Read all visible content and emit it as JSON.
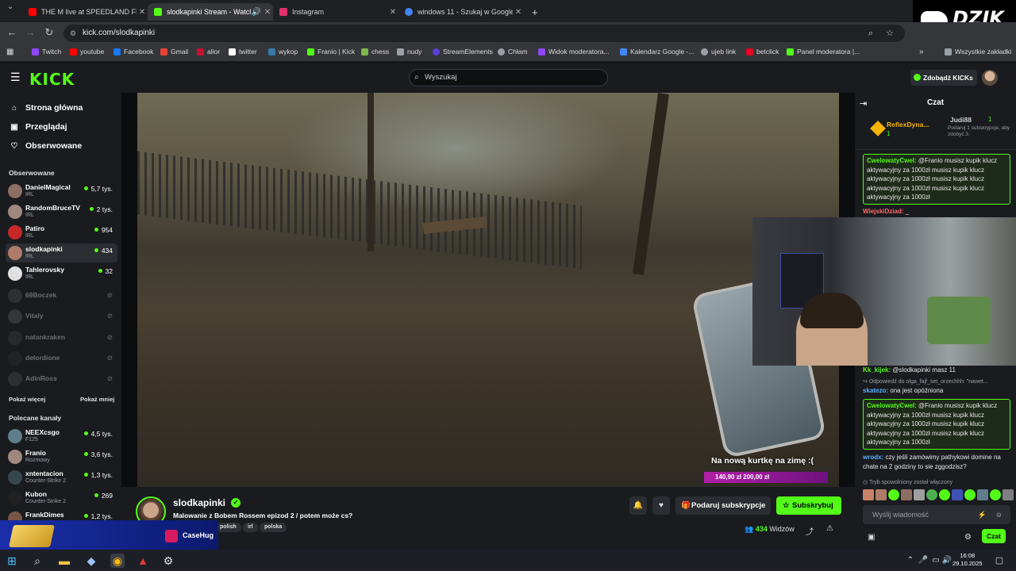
{
  "browser": {
    "tabs": [
      {
        "title": "THE M live at SPEEDLAND FEST",
        "color": "#ff0000"
      },
      {
        "title": "slodkapinki Stream - Watch",
        "color": "#53fc18"
      },
      {
        "title": "Instagram",
        "color": "#e1306c"
      },
      {
        "title": "windows 11 - Szukaj w Google",
        "color": "#4285f4"
      }
    ],
    "url": "kick.com/slodkapinki",
    "bookmarks": [
      {
        "label": "Twitch",
        "color": "#9146ff"
      },
      {
        "label": "youtube",
        "color": "#ff0000"
      },
      {
        "label": "Facebook",
        "color": "#1877f2"
      },
      {
        "label": "Gmail",
        "color": "#ea4335"
      },
      {
        "label": "alior",
        "color": "#c8102e"
      },
      {
        "label": "twitter",
        "color": "#ffffff"
      },
      {
        "label": "wykop",
        "color": "#367aa9"
      },
      {
        "label": "Franio | Kick",
        "color": "#53fc18"
      },
      {
        "label": "chess",
        "color": "#81b64c"
      },
      {
        "label": "nudy",
        "color": "#9aa0a6"
      },
      {
        "label": "StreamElements",
        "color": "#5a3fd6"
      },
      {
        "label": "Chłam",
        "color": "#9aa0a6"
      },
      {
        "label": "Widok moderatora...",
        "color": "#9146ff"
      },
      {
        "label": "Kalendarz Google -...",
        "color": "#4285f4"
      },
      {
        "label": "ujeb link",
        "color": "#9aa0a6"
      },
      {
        "label": "betclick",
        "color": "#e40521"
      },
      {
        "label": "Panel moderatora |...",
        "color": "#53fc18"
      }
    ],
    "all_bookmarks": "Wszystkie zakładki"
  },
  "kick": {
    "logo": "KICK",
    "search_placeholder": "Wyszukaj",
    "kicks_button": "Zdobądź KICKs",
    "nav": [
      "Strona główna",
      "Przeglądaj",
      "Obserwowane"
    ],
    "followed_heading": "Obserwowane",
    "followed": [
      {
        "name": "DanielMagical",
        "cat": "IRL",
        "viewers": "5,7 tys.",
        "color": "#8d6e63"
      },
      {
        "name": "RandomBruceTV",
        "cat": "IRL",
        "viewers": "2 tys.",
        "color": "#a1887f"
      },
      {
        "name": "Patiro",
        "cat": "IRL",
        "viewers": "954",
        "color": "#c62828"
      },
      {
        "name": "slodkapinki",
        "cat": "IRL",
        "viewers": "434",
        "color": "#b07c6a"
      },
      {
        "name": "Tahlerovsky",
        "cat": "IRL",
        "viewers": "32",
        "color": "#e0e0e0"
      },
      {
        "name": "69Boczek",
        "cat": "",
        "viewers": "",
        "color": "#555555"
      },
      {
        "name": "Vitaly",
        "cat": "",
        "viewers": "",
        "color": "#666666"
      },
      {
        "name": "natankraken",
        "cat": "",
        "viewers": "",
        "color": "#444444"
      },
      {
        "name": "delordione",
        "cat": "",
        "viewers": "",
        "color": "#333333"
      },
      {
        "name": "AdinRoss",
        "cat": "",
        "viewers": "",
        "color": "#555555"
      }
    ],
    "show_more": "Pokaż więcej",
    "show_less": "Pokaż mniej",
    "recommended_heading": "Polecane kanały",
    "recommended": [
      {
        "name": "NEEXcsgo",
        "cat": "F125",
        "viewers": "4,5 tys.",
        "color": "#607d8b"
      },
      {
        "name": "Franio",
        "cat": "Rozmowy",
        "viewers": "3,6 tys.",
        "color": "#a1887f"
      },
      {
        "name": "xntentacion",
        "cat": "Counter-Strike 2",
        "viewers": "1,3 tys.",
        "color": "#37474f"
      },
      {
        "name": "Kubon",
        "cat": "Counter-Strike 2",
        "viewers": "269",
        "color": "#212121"
      },
      {
        "name": "FrankDimes",
        "cat": "",
        "viewers": "1,2 tys.",
        "color": "#795548"
      }
    ]
  },
  "video": {
    "caption": "Na nową kurtkę na zimę :(",
    "donation": "140,90 zł   200,00 zł"
  },
  "stream": {
    "streamer": "slodkapinki",
    "title": "Malowanie z Bobem Rossem epizod 2 / potem może cs?",
    "tags": [
      "polish",
      "irl",
      "polska"
    ],
    "gift_button": "Podaruj subskrypcje",
    "subscribe_button": "Subskrybuj",
    "viewers_count": "434",
    "viewers_label": "Widzów"
  },
  "chat": {
    "title": "Czat",
    "pinned": {
      "user": "ReflexDyna...",
      "count": "1",
      "user2": "Judi88",
      "count2": "1",
      "gift_text": "Podaruj 1 subskrypcje, aby zdobyć 3."
    },
    "messages": [
      {
        "user": "CwelowatyCwel:",
        "text": "@Franio musisz kupik klucz aktywacyjny za 1000zł musisz kupik klucz aktywacyjny za 1000zł musisz kupik klucz aktywacyjny za 1000zł musisz kupik klucz aktywacyjny za 1000zł",
        "color": "#53fc18"
      },
      {
        "user": "WiejskiDziad:",
        "text": "_",
        "color": "#ff6b6b"
      },
      {
        "user": "Kk_kijek:",
        "text": "@slodkapinki masz 11",
        "color": "#53fc18"
      },
      {
        "user": "",
        "text": "Odpowiedź do olga_fajf_set_orzechhh: \"nawet...",
        "color": "#9aa0a6"
      },
      {
        "user": "skatezo:",
        "text": "ona jest opóźniona",
        "color": "#5ab0ff"
      },
      {
        "user": "CwelowatyCwel:",
        "text": "@Franio musisz kupik klucz aktywacyjny za 1000zł musisz kupik klucz aktywacyjny za 1000zł musisz kupik klucz aktywacyjny za 1000zł musisz kupik klucz aktywacyjny za 1000zł",
        "color": "#53fc18"
      },
      {
        "user": "wrodx:",
        "text": "czy jeśli zamówimy pathykowi domine na chate na 2 godziny to sie zggodzisz?",
        "color": "#5ab0ff"
      }
    ],
    "slow_mode": "Tryb spowolniony został włączony",
    "input_placeholder": "Wyślij wiadomość",
    "send_button": "Czat"
  },
  "overlay": {
    "dzik": "DZIK",
    "casehug": "CaseHug"
  },
  "taskbar": {
    "time": "16:08",
    "date": "29.10.2025"
  }
}
